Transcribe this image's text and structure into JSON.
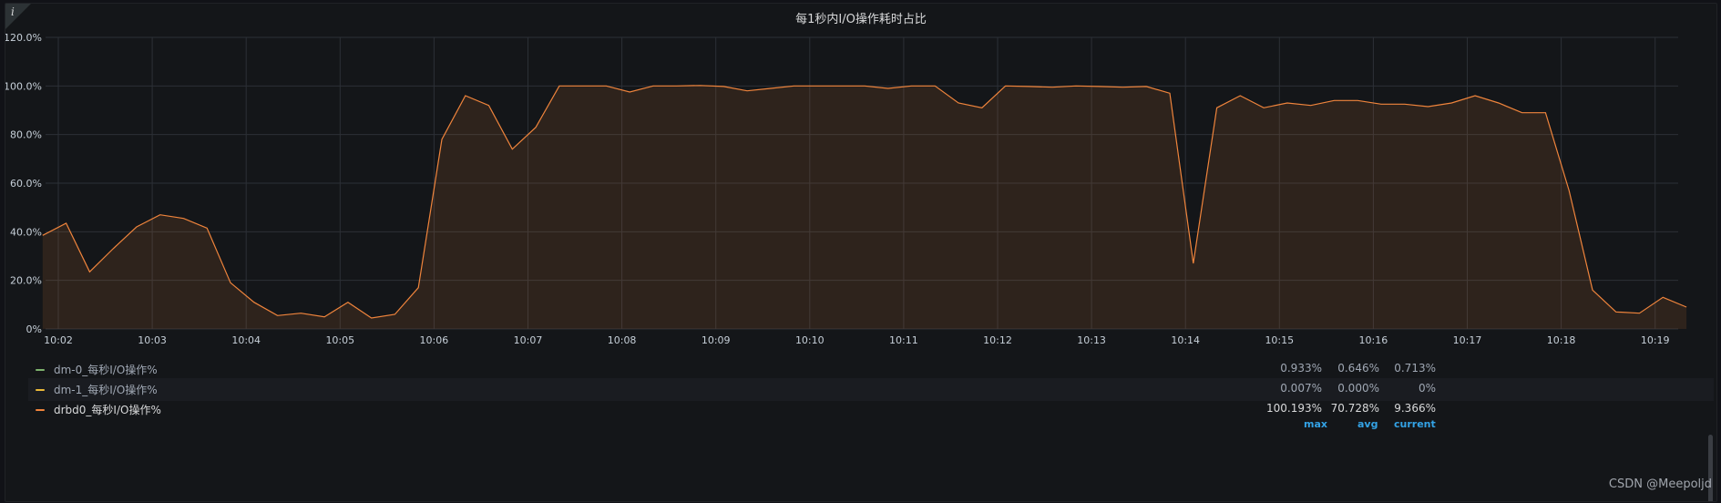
{
  "panel": {
    "title": "每1秒内I/O操作耗时占比",
    "info_icon": "info-icon"
  },
  "legend": {
    "headers": {
      "max": "max",
      "avg": "avg",
      "current": "current"
    },
    "rows": [
      {
        "name": "dm-0_每秒I/O操作%",
        "max": "0.933%",
        "avg": "0.646%",
        "current": "0.713%",
        "color": "#7eb26d"
      },
      {
        "name": "dm-1_每秒I/O操作%",
        "max": "0.007%",
        "avg": "0.000%",
        "current": "0%",
        "color": "#eab839"
      },
      {
        "name": "drbd0_每秒I/O操作%",
        "max": "100.193%",
        "avg": "70.728%",
        "current": "9.366%",
        "color": "#ef843c"
      }
    ]
  },
  "watermark": "CSDN @Meepoljd",
  "chart_data": {
    "type": "area",
    "title": "每1秒内I/O操作耗时占比",
    "ylim": [
      0,
      120
    ],
    "ytick_labels": [
      "0%",
      "20.0%",
      "40.0%",
      "60.0%",
      "80.0%",
      "100.0%",
      "120.0%"
    ],
    "ytick_values": [
      0,
      20,
      40,
      60,
      80,
      100,
      120
    ],
    "xtick_labels": [
      "10:02",
      "10:03",
      "10:04",
      "10:05",
      "10:06",
      "10:07",
      "10:08",
      "10:09",
      "10:10",
      "10:11",
      "10:12",
      "10:13",
      "10:14",
      "10:15",
      "10:16",
      "10:17",
      "10:18",
      "10:19"
    ],
    "x_start": "10:01:50",
    "x_step_seconds": 15,
    "grid": true,
    "series": [
      {
        "name": "drbd0_每秒I/O操作%",
        "color": "#ef843c",
        "values": [
          38.5,
          43.5,
          23.5,
          33,
          42,
          47,
          45.5,
          41.5,
          19,
          11,
          5.5,
          6.5,
          5,
          11,
          4.5,
          6,
          17,
          78,
          96,
          92,
          74,
          83,
          100,
          100,
          100,
          97.5,
          100,
          100,
          100.2,
          99.8,
          98,
          99,
          100,
          100,
          100,
          100,
          99,
          100,
          100,
          93,
          91,
          100,
          99.8,
          99.5,
          100,
          99.8,
          99.5,
          99.8,
          97,
          27,
          91,
          96,
          91,
          93,
          92,
          94,
          94,
          92.5,
          92.5,
          91.5,
          93,
          96,
          93,
          89,
          89,
          57,
          16,
          7,
          6.5,
          13,
          9
        ]
      }
    ]
  }
}
